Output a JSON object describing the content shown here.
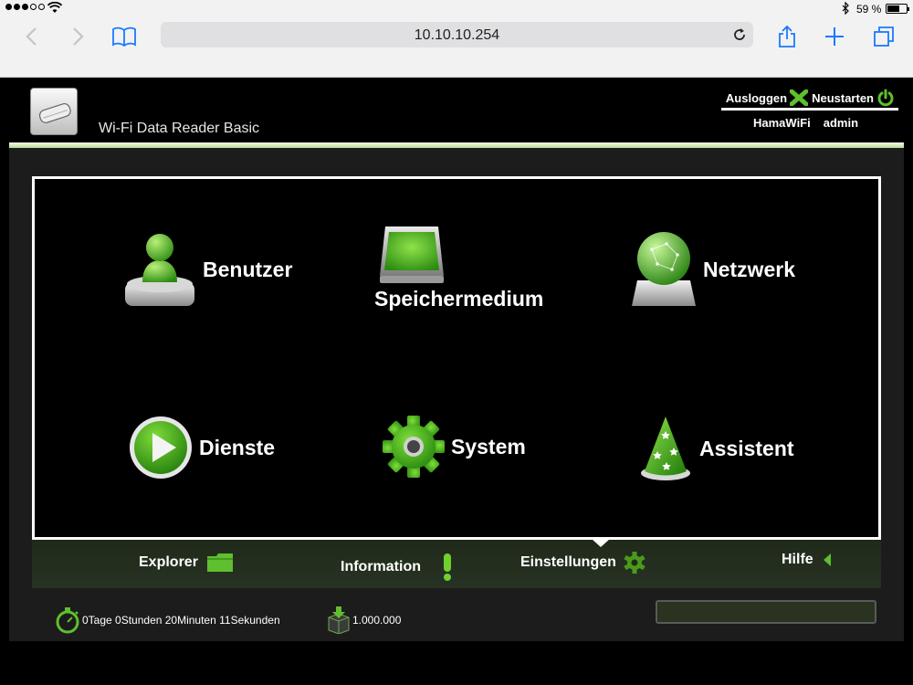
{
  "status_bar": {
    "battery_text": "59 %",
    "battery_level": 0.59,
    "signal_dots_filled": 3,
    "signal_dots_total": 5
  },
  "browser": {
    "url": "10.10.10.254",
    "icons": [
      "back-icon",
      "forward-icon",
      "bookmarks-icon",
      "reload-icon",
      "share-icon",
      "new-tab-icon",
      "tabs-icon"
    ]
  },
  "header": {
    "product_name": "Wi-Fi Data Reader Basic",
    "logout_label": "Ausloggen",
    "restart_label": "Neustarten",
    "ssid": "HamaWiFi",
    "user": "admin"
  },
  "tiles": [
    {
      "label": "Benutzer",
      "icon": "user-icon"
    },
    {
      "label": "Speichermedium",
      "icon": "storage-icon"
    },
    {
      "label": "Netzwerk",
      "icon": "globe-icon"
    },
    {
      "label": "Dienste",
      "icon": "play-icon"
    },
    {
      "label": "System",
      "icon": "gear-icon"
    },
    {
      "label": "Assistent",
      "icon": "wizard-hat-icon"
    }
  ],
  "tabs": [
    {
      "label": "Explorer",
      "icon": "folder-icon"
    },
    {
      "label": "Information",
      "icon": "exclamation-icon"
    },
    {
      "label": "Einstellungen",
      "icon": "gear-small-icon",
      "active": true
    },
    {
      "label": "Hilfe",
      "icon": "arrow-left-icon"
    }
  ],
  "footer": {
    "uptime": "0Tage 0Stunden 20Minuten 11Sekunden",
    "counter": "1.000.000"
  },
  "colors": {
    "accent_green": "#4caf28",
    "panel_bg": "#1c1c1c",
    "tabbar_bg": "#283224"
  }
}
